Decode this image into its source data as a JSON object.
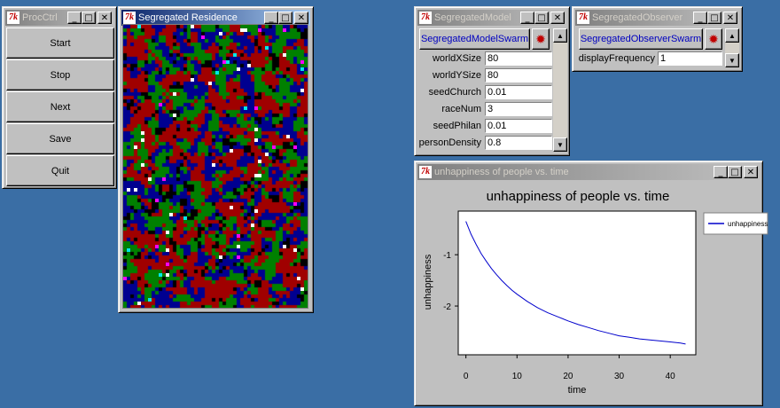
{
  "procctrl": {
    "title": "ProcCtrl",
    "buttons": [
      "Start",
      "Stop",
      "Next",
      "Save",
      "Quit"
    ]
  },
  "residence": {
    "title": "Segregated Residence",
    "colors": [
      "#a00000",
      "#008000",
      "#000090",
      "#000000"
    ],
    "dot_colors": [
      "#ffffff",
      "#00e8e8",
      "#ff00ff"
    ]
  },
  "model": {
    "title": "SegregatedModel",
    "swarm_button": "SegregatedModelSwarm",
    "params": [
      {
        "label": "worldXSize",
        "value": "80"
      },
      {
        "label": "worldYSize",
        "value": "80"
      },
      {
        "label": "seedChurch",
        "value": "0.01"
      },
      {
        "label": "raceNum",
        "value": "3"
      },
      {
        "label": "seedPhilan",
        "value": "0.01"
      },
      {
        "label": "personDensity",
        "value": "0.8"
      }
    ]
  },
  "observer": {
    "title": "SegregatedObserver",
    "swarm_button": "SegregatedObserverSwarm",
    "params": [
      {
        "label": "displayFrequency",
        "value": "1"
      }
    ]
  },
  "plot_window": {
    "title": "unhappiness of people vs. time"
  },
  "chart_data": {
    "type": "line",
    "title": "unhappiness of people vs. time",
    "xlabel": "time",
    "ylabel": "unhappiness",
    "xlim": [
      -1.5,
      45
    ],
    "ylim": [
      -2.95,
      -0.15
    ],
    "xticks": [
      0,
      10,
      20,
      30,
      40
    ],
    "yticks": [
      -1,
      -2
    ],
    "legend_position": "right",
    "series": [
      {
        "name": "unhappiness",
        "color": "#0000cc",
        "x": [
          0,
          1,
          2,
          3,
          4,
          5,
          6,
          7,
          8,
          9,
          10,
          12,
          14,
          16,
          18,
          20,
          22,
          24,
          26,
          28,
          30,
          32,
          34,
          36,
          38,
          40,
          42,
          43
        ],
        "y": [
          -0.35,
          -0.6,
          -0.8,
          -0.98,
          -1.13,
          -1.27,
          -1.39,
          -1.5,
          -1.6,
          -1.69,
          -1.77,
          -1.91,
          -2.03,
          -2.13,
          -2.21,
          -2.29,
          -2.36,
          -2.42,
          -2.48,
          -2.53,
          -2.58,
          -2.61,
          -2.64,
          -2.66,
          -2.68,
          -2.7,
          -2.72,
          -2.74
        ]
      }
    ]
  }
}
